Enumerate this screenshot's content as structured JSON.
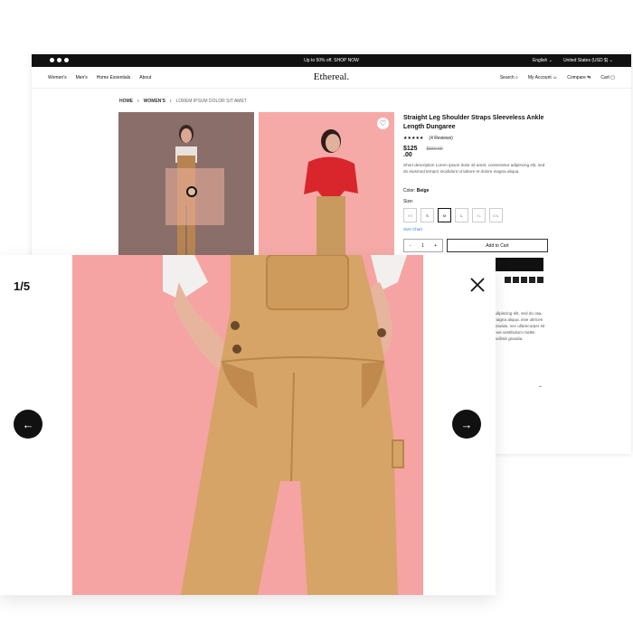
{
  "topbar": {
    "promo": "Up to 50% off. SHOP NOW",
    "language": "English",
    "currency": "United States (USD $)"
  },
  "nav": {
    "links": [
      "Women's",
      "Men's",
      "Home Essentials",
      "About"
    ],
    "logo": "Ethereal.",
    "search": "Search",
    "account": "My Account",
    "compare": "Compare",
    "cart": "Cart"
  },
  "breadcrumb": {
    "home": "HOME",
    "category": "WOMEN'S",
    "current": "LOREM IPSUM DOLOR SIT AMET"
  },
  "product": {
    "title": "Straight Leg Shoulder Straps Sleeveless Ankle Length Dungaree",
    "stars": "★★★★★",
    "reviews": "(4 Reviews)",
    "price": "$125",
    "cents": ".00",
    "old_price": "$150.00",
    "description": "Short description Lorem ipsum dolor sit amet, consectetur adipiscing elit, sed do eiusmod tempor incididunt ut labore et dolore magna aliqua.",
    "color_label": "Color:",
    "color_value": "Beige",
    "size_label": "Size:",
    "sizes": [
      "XS",
      "S",
      "M",
      "L",
      "XL",
      "XXL"
    ],
    "size_chart": "Size Chart",
    "qty": "1",
    "add_to_cart": "Add to Cart",
    "accordion_text": "adipiscing elit, sed do ore magna aliqua. isse ultrices gravida. nec ullamcorper sit mus vestibulum mattis facilisis gravida."
  },
  "lightbox": {
    "counter": "1/5",
    "prev": "←",
    "next": "→"
  },
  "colors": {
    "pink_bg": "#f5a3a3",
    "overalls": "#d6a466",
    "dark": "#111111"
  }
}
